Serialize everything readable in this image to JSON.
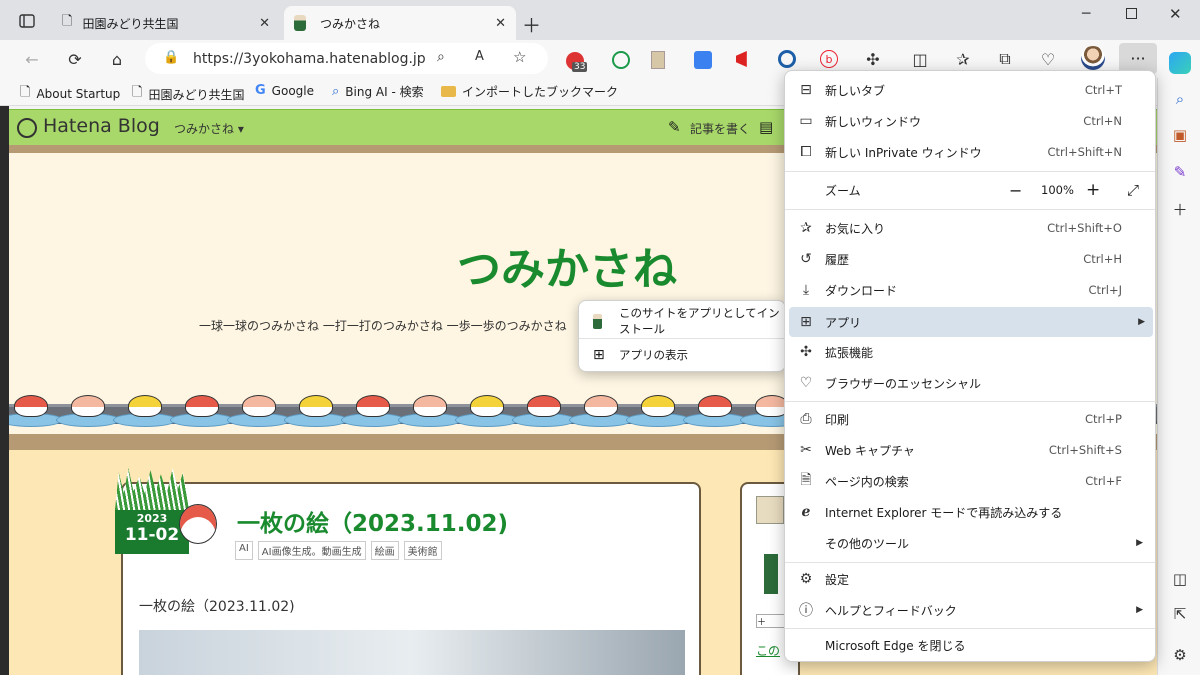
{
  "tabs": [
    {
      "title": "田園みどり共生国",
      "icon": "page-icon"
    },
    {
      "title": "つみかさね",
      "icon": "avatar-favicon"
    }
  ],
  "address": {
    "url": "https://3yokohama.hatenablog.jp"
  },
  "extension_badge": "33",
  "bookmarks": [
    {
      "label": "About Startup",
      "icon": "page-icon"
    },
    {
      "label": "田園みどり共生国",
      "icon": "page-icon"
    },
    {
      "label": "Google",
      "icon": "google-icon"
    },
    {
      "label": "Bing AI - 検索",
      "icon": "search-icon"
    },
    {
      "label": "インポートしたブックマーク",
      "icon": "folder-icon"
    }
  ],
  "blog": {
    "logo": "Hatena Blog",
    "blog_menu": "つみかさね ▾",
    "write_label": "記事を書く",
    "title": "つみかさね",
    "tagline": "一球一球のつみかさね 一打一打のつみかさね 一歩一歩のつみかさね",
    "post": {
      "year": "2023",
      "date": "11-02",
      "title": "一枚の絵（2023.11.02)",
      "tags": [
        "AI",
        "AI画像生成。動画生成",
        "絵画",
        "美術館"
      ],
      "body_first_line": "一枚の絵（2023.11.02)"
    },
    "side_link": "この"
  },
  "menu": {
    "items": [
      {
        "label": "新しいタブ",
        "key": "Ctrl+T",
        "icon": "new-tab-icon"
      },
      {
        "label": "新しいウィンドウ",
        "key": "Ctrl+N",
        "icon": "window-icon"
      },
      {
        "label": "新しい InPrivate ウィンドウ",
        "key": "Ctrl+Shift+N",
        "icon": "inprivate-icon"
      },
      {
        "label": "お気に入り",
        "key": "Ctrl+Shift+O",
        "icon": "favorites-icon"
      },
      {
        "label": "履歴",
        "key": "Ctrl+H",
        "icon": "history-icon"
      },
      {
        "label": "ダウンロード",
        "key": "Ctrl+J",
        "icon": "download-icon"
      },
      {
        "label": "アプリ",
        "key": "",
        "icon": "apps-icon"
      },
      {
        "label": "拡張機能",
        "key": "",
        "icon": "extensions-icon"
      },
      {
        "label": "ブラウザーのエッセンシャル",
        "key": "",
        "icon": "essentials-icon"
      },
      {
        "label": "印刷",
        "key": "Ctrl+P",
        "icon": "print-icon"
      },
      {
        "label": "Web キャプチャ",
        "key": "Ctrl+Shift+S",
        "icon": "capture-icon"
      },
      {
        "label": "ページ内の検索",
        "key": "Ctrl+F",
        "icon": "find-icon"
      },
      {
        "label": "Internet Explorer モードで再読み込みする",
        "key": "",
        "icon": "ie-icon"
      },
      {
        "label": "その他のツール",
        "key": "",
        "icon": ""
      },
      {
        "label": "設定",
        "key": "",
        "icon": "settings-icon"
      },
      {
        "label": "ヘルプとフィードバック",
        "key": "",
        "icon": "help-icon"
      },
      {
        "label": "Microsoft Edge を閉じる",
        "key": "",
        "icon": ""
      }
    ],
    "zoom": {
      "label": "ズーム",
      "value": "100%",
      "minus": "−",
      "plus": "+"
    }
  },
  "submenu": {
    "items": [
      {
        "label": "このサイトをアプリとしてインストール"
      },
      {
        "label": "アプリの表示"
      }
    ]
  },
  "colors": {
    "accent_green": "#1a8a2e",
    "header_green": "#a8d86a",
    "menu_highlight": "#d7e1ec"
  }
}
